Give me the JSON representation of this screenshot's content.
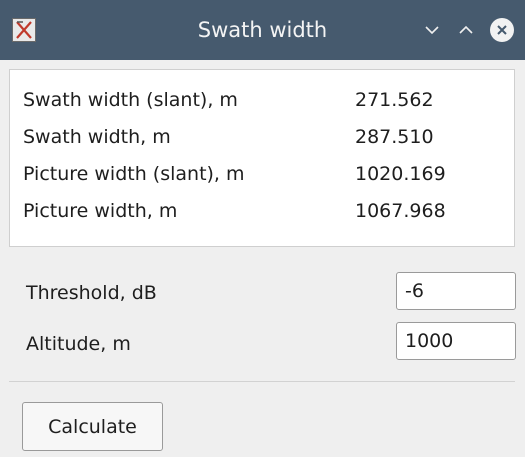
{
  "window": {
    "title": "Swath width"
  },
  "results": [
    {
      "label": "Swath width (slant), m",
      "value": "271.562"
    },
    {
      "label": "Swath width, m",
      "value": "287.510"
    },
    {
      "label": "Picture width (slant), m",
      "value": "1020.169"
    },
    {
      "label": "Picture width, m",
      "value": "1067.968"
    }
  ],
  "inputs": {
    "threshold": {
      "label": "Threshold, dB",
      "value": "-6"
    },
    "altitude": {
      "label": "Altitude, m",
      "value": "1000"
    }
  },
  "actions": {
    "calculate_label": "Calculate"
  },
  "icons": {
    "app": "app-icon",
    "minimize": "chevron-down-icon",
    "maximize": "chevron-up-icon",
    "close": "close-icon"
  },
  "colors": {
    "titlebar": "#465a6e",
    "window_bg": "#efefef",
    "panel_bg": "#ffffff"
  }
}
